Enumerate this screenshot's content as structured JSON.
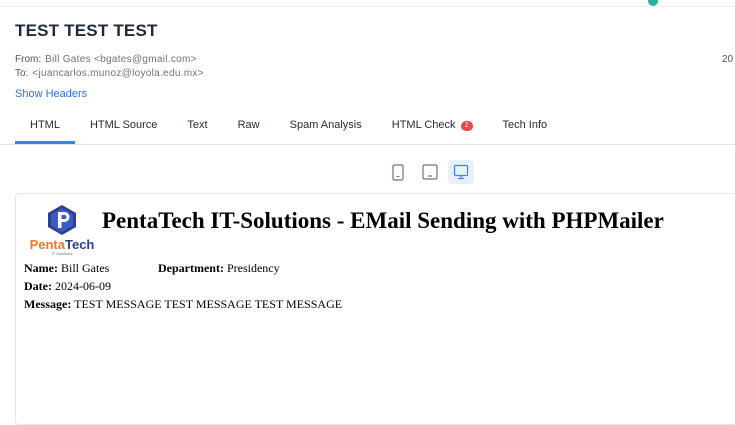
{
  "subject": "TEST TEST TEST",
  "from": {
    "label": "From:",
    "value": "Bill Gates <bgates@gmail.com>"
  },
  "to": {
    "label": "To:",
    "value": "<juancarlos.munoz@loyola.edu.mx>"
  },
  "date_partial": "20",
  "show_headers": "Show Headers",
  "tabs": [
    {
      "label": "HTML",
      "active": true
    },
    {
      "label": "HTML Source"
    },
    {
      "label": "Text"
    },
    {
      "label": "Raw"
    },
    {
      "label": "Spam Analysis"
    },
    {
      "label": "HTML Check",
      "badge": "2"
    },
    {
      "label": "Tech Info"
    }
  ],
  "device_buttons": {
    "phone": "phone-icon",
    "tablet": "tablet-icon",
    "desktop": "desktop-icon",
    "active": "desktop"
  },
  "email": {
    "logo": {
      "brand_part1": "Penta",
      "brand_part2": "Tech",
      "tagline": "IT Solutions"
    },
    "heading": "PentaTech IT-Solutions - EMail Sending with PHPMailer",
    "name_label": "Name:",
    "name_value": "Bill Gates",
    "department_label": "Department:",
    "department_value": "Presidency",
    "date_label": "Date:",
    "date_value": "2024-06-09",
    "message_label": "Message:",
    "message_value": "TEST MESSAGE TEST MESSAGE TEST MESSAGE"
  },
  "colors": {
    "accent": "#3b82f6",
    "link": "#2f6fd6",
    "badge": "#ef4444",
    "logo_orange": "#f07a2a",
    "logo_navy": "#2c3e91"
  }
}
